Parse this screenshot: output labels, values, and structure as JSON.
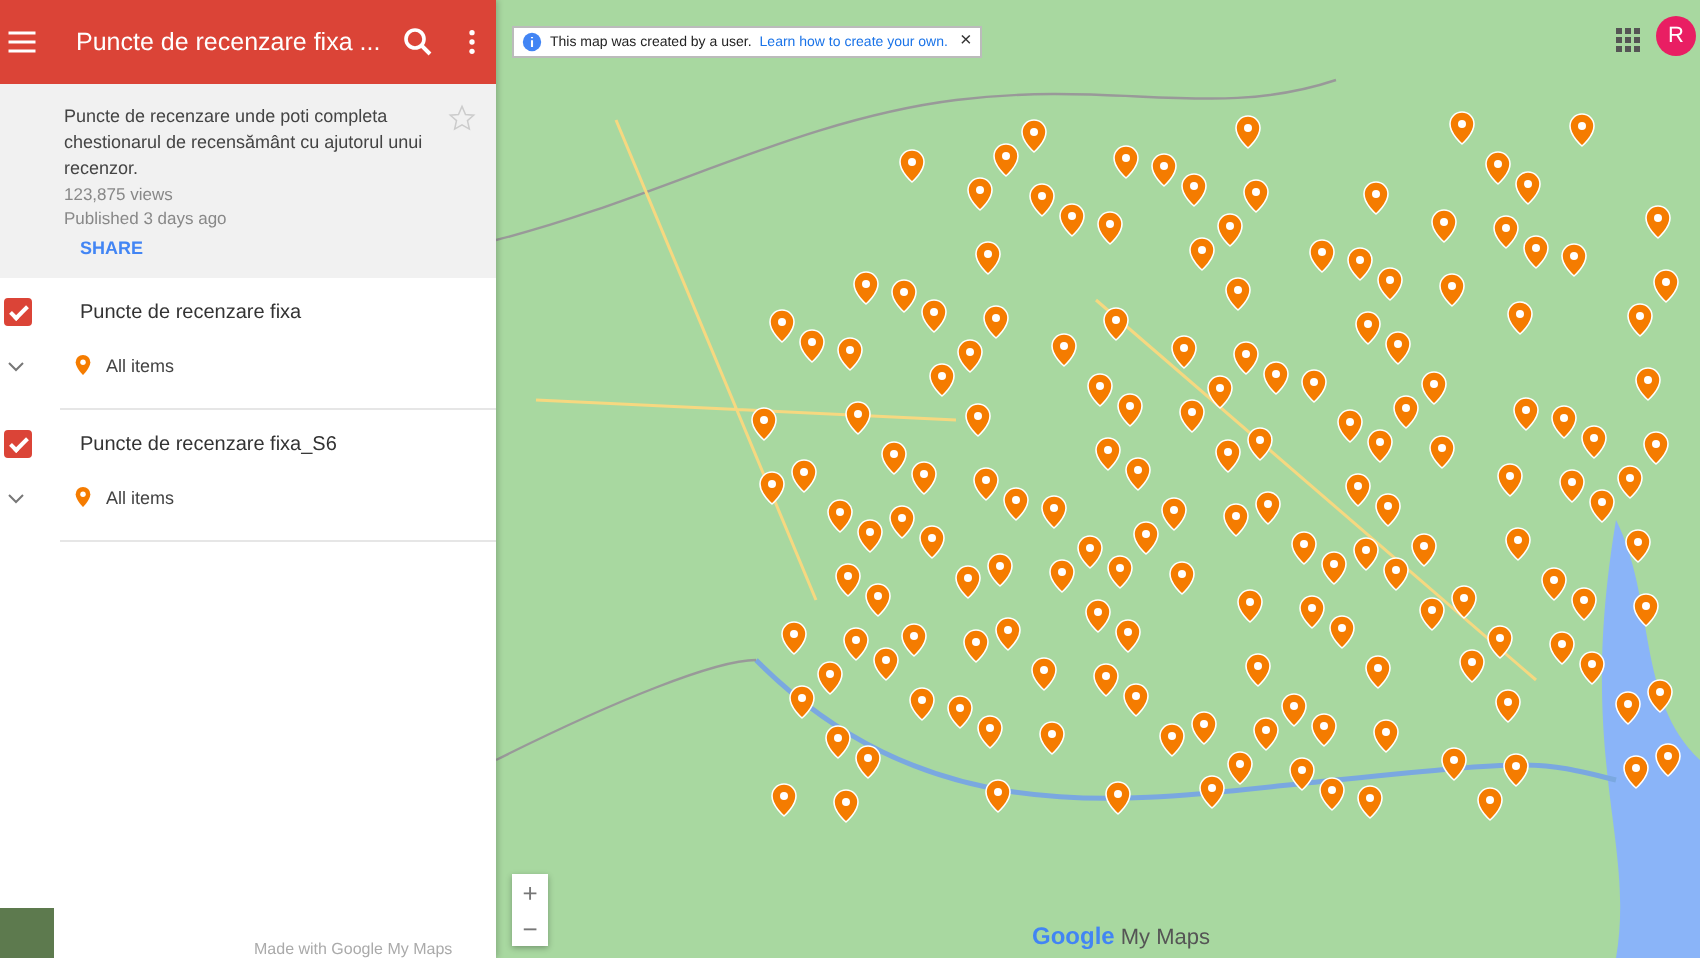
{
  "header": {
    "title": "Puncte de recenzare fixa ..."
  },
  "info": {
    "description": "Puncte de recenzare unde poti completa chestionarul de recensământ cu ajutorul unui recenzor.",
    "views": "123,875 views",
    "published": "Published 3 days ago",
    "share": "SHARE",
    "starred": false
  },
  "layers": [
    {
      "name": "Puncte de recenzare fixa",
      "checked": true,
      "expanded": false,
      "items_label": "All items"
    },
    {
      "name": "Puncte de recenzare fixa_S6",
      "checked": true,
      "expanded": false,
      "items_label": "All items"
    }
  ],
  "footer": {
    "credit": "Made with Google My Maps"
  },
  "map": {
    "notice": "This map was created by a user.",
    "notice_link": "Learn how to create your own.",
    "close": "×",
    "zoom_in": "+",
    "zoom_out": "−",
    "logo_google": "Google",
    "logo_product": "My Maps",
    "avatar": "R"
  }
}
